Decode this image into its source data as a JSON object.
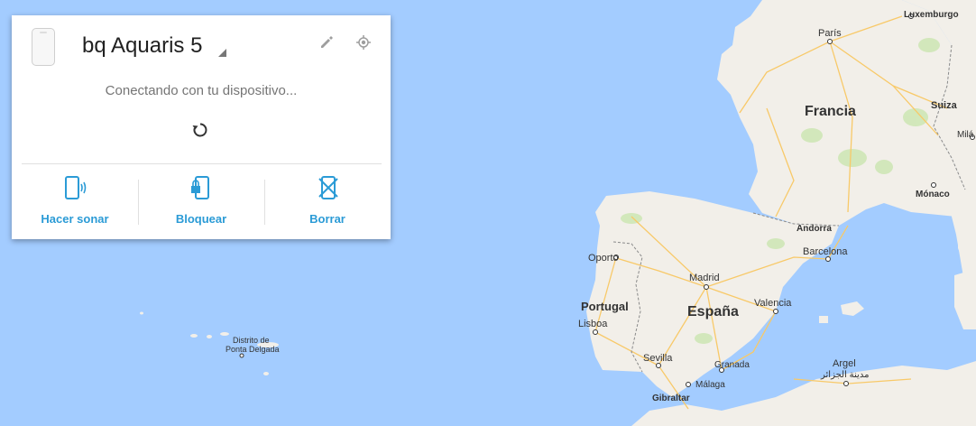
{
  "map": {
    "country_labels": {
      "francia": "Francia",
      "espana": "España",
      "portugal": "Portugal",
      "suiza": "Suiza",
      "andorra": "Andorra"
    },
    "city_labels": {
      "paris": "París",
      "luxemburgo": "Luxemburgo",
      "mila": "Milá",
      "monaco": "Mónaco",
      "barcelona": "Barcelona",
      "madrid": "Madrid",
      "valencia": "Valencia",
      "oporto": "Oporto",
      "lisboa": "Lisboa",
      "sevilla": "Sevilla",
      "granada": "Granada",
      "malaga": "Málaga",
      "gibraltar": "Gibraltar",
      "argel": "Argel",
      "argel_ar": "مدينة الجزائر",
      "ponta_delgada_1": "Distrito de",
      "ponta_delgada_2": "Ponta Delgada"
    },
    "colors": {
      "water": "#a3ccff",
      "land": "#f2efe9",
      "green": "#cde6b3",
      "roads": "#f8c968",
      "border": "#8a8a8a"
    }
  },
  "device_card": {
    "device_name": "bq Aquaris 5",
    "status_text": "Conectando con tu dispositivo...",
    "icons": {
      "thumbnail": "phone-thumbnail-icon",
      "dropdown": "dropdown-triangle-icon",
      "edit": "pencil-icon",
      "locate": "locate-icon",
      "refresh": "refresh-icon"
    },
    "actions": [
      {
        "label": "Hacer sonar",
        "icon": "phone-ring-icon"
      },
      {
        "label": "Bloquear",
        "icon": "phone-lock-icon"
      },
      {
        "label": "Borrar",
        "icon": "phone-erase-icon"
      }
    ],
    "accent_color": "#2b9bd6"
  }
}
